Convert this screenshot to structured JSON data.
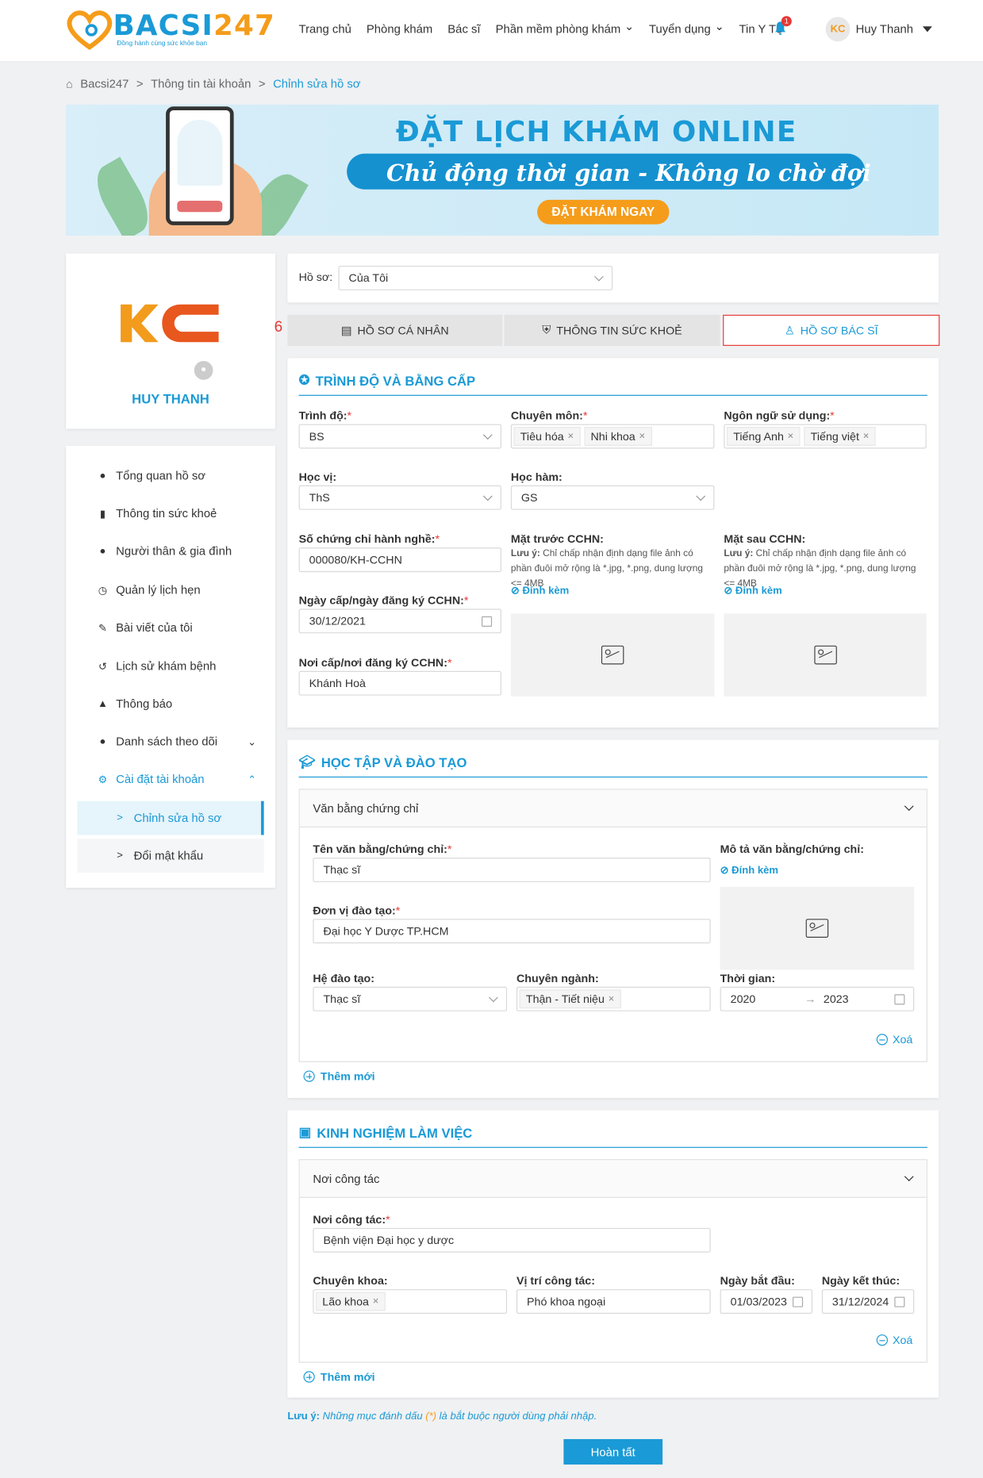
{
  "header": {
    "logo_text_1": "BACSI",
    "logo_text_2": "247",
    "logo_tagline": "Đồng hành cùng sức khỏe bạn",
    "nav": [
      "Trang chủ",
      "Phòng khám",
      "Bác sĩ",
      "Phần mềm phòng khám",
      "Tuyển dụng",
      "Tin Y Tế"
    ],
    "notification_count": "1",
    "user_avatar_text": "KC",
    "user_name": "Huy Thanh"
  },
  "breadcrumb": [
    "Bacsi247",
    ">",
    "Thông tin tài khoản",
    ">",
    "Chỉnh sửa hồ sơ"
  ],
  "banner": {
    "title": "ĐẶT LỊCH KHÁM ONLINE",
    "subtitle": "Chủ động thời gian - Không lo chờ đợi",
    "cta": "ĐẶT KHÁM NGAY"
  },
  "profile": {
    "logo_text": "KC",
    "name": "HUY THANH"
  },
  "menu": {
    "items": [
      "Tổng quan hồ sơ",
      "Thông tin sức khoẻ",
      "Người thân & gia đình",
      "Quản lý lịch hẹn",
      "Bài viết của tôi",
      "Lịch sử khám bệnh",
      "Thông báo",
      "Danh sách theo dõi",
      "Cài đặt tài khoản"
    ],
    "sub": [
      ">",
      "Chỉnh sửa hồ sơ",
      "Đổi mật khẩu"
    ]
  },
  "profile_select": {
    "label": "Hồ sơ:",
    "value": "Của Tôi"
  },
  "tabs": [
    "HỒ SƠ CÁ NHÂN",
    "THÔNG TIN SỨC KHOẺ",
    "HỒ SƠ BÁC SĨ"
  ],
  "annotation_number": "6",
  "section1": {
    "title": "TRÌNH ĐỘ VÀ BẰNG CẤP",
    "trinh_do": {
      "label": "Trình độ:",
      "value": "BS"
    },
    "chuyen_mon": {
      "label": "Chuyên môn:",
      "tags": [
        "Tiêu hóa",
        "Nhi khoa"
      ]
    },
    "ngon_ngu": {
      "label": "Ngôn ngữ sử dụng:",
      "tags": [
        "Tiếng Anh",
        "Tiếng việt"
      ]
    },
    "hoc_vi": {
      "label": "Học vị:",
      "value": "ThS"
    },
    "hoc_ham": {
      "label": "Học hàm:",
      "value": "GS"
    },
    "so_chung_chi": {
      "label": "Số chứng chỉ hành nghề:",
      "value": "000080/KH-CCHN"
    },
    "ngay_cap": {
      "label": "Ngày cấp/ngày đăng ký CCHN:",
      "value": "30/12/2021"
    },
    "noi_cap": {
      "label": "Nơi cấp/nơi đăng ký CCHN:",
      "value": "Khánh Hoà"
    },
    "mat_truoc": {
      "label": "Mặt trước CCHN:"
    },
    "mat_sau": {
      "label": "Mặt sau CCHN:"
    },
    "note_bold": "Lưu ý:",
    "note_text": " Chỉ chấp nhận định dạng file ảnh có phần đuôi mở rộng là *.jpg, *.png, dung lượng <= 4MB",
    "attach": "Đính kèm"
  },
  "section2": {
    "title": "HỌC TẬP VÀ ĐÀO TẠO",
    "acc_title": "Văn bằng chứng chỉ",
    "ten_van_bang": {
      "label": "Tên văn bằng/chứng chỉ:",
      "value": "Thạc sĩ"
    },
    "mo_ta": {
      "label": "Mô tả văn bằng/chứng chỉ:"
    },
    "don_vi": {
      "label": "Đơn vị đào tạo:",
      "value": "Đại học Y Dược TP.HCM"
    },
    "he_dao_tao": {
      "label": "Hệ đào tạo:",
      "value": "Thạc sĩ"
    },
    "chuyen_nganh": {
      "label": "Chuyên ngành:",
      "tag": "Thận - Tiết niệu"
    },
    "thoi_gian": {
      "label": "Thời gian:",
      "from": "2020",
      "arrow": "→",
      "to": "2023"
    },
    "delete": "Xoá",
    "add": "Thêm mới"
  },
  "section3": {
    "title": "KINH NGHIỆM LÀM VIỆC",
    "acc_title": "Nơi công tác",
    "noi_cong_tac": {
      "label": "Nơi công tác:",
      "value": "Bệnh viện Đại học y dược"
    },
    "chuyen_khoa": {
      "label": "Chuyên khoa:",
      "tag": "Lão khoa"
    },
    "vi_tri": {
      "label": "Vị trí công tác:",
      "value": "Phó khoa ngoại"
    },
    "ngay_bat_dau": {
      "label": "Ngày bắt đầu:",
      "value": "01/03/2023"
    },
    "ngay_ket_thuc": {
      "label": "Ngày kết thúc:",
      "value": "31/12/2024"
    },
    "delete": "Xoá",
    "add": "Thêm mới"
  },
  "footer_note": {
    "bold": "Lưu ý:",
    "text1": " Những mục đánh dấu ",
    "star": "(*)",
    "text2": " là bắt buộc người dùng phải nhập."
  },
  "submit": "Hoàn tất",
  "req": "*",
  "x": "×",
  "colors": {
    "primary": "#1a9ad6",
    "orange": "#f59c1a",
    "danger": "#e53935"
  }
}
